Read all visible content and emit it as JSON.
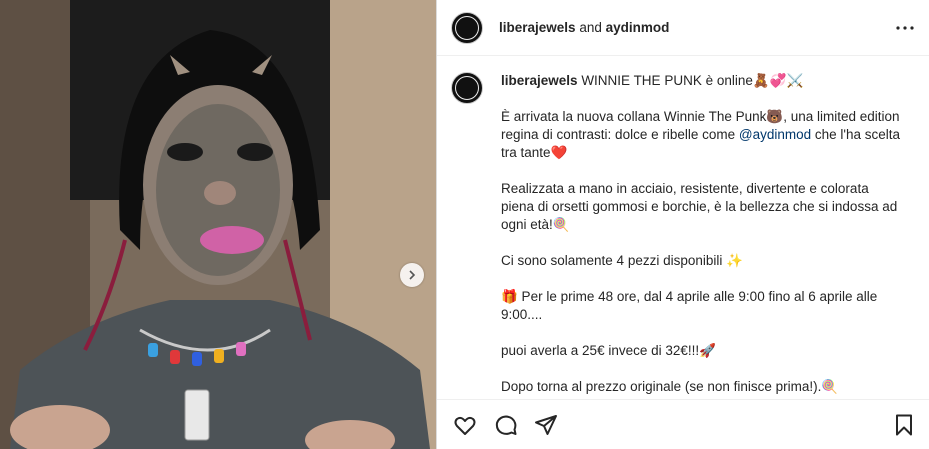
{
  "header": {
    "user1": "liberajewels",
    "and": "and",
    "user2": "aydinmod"
  },
  "caption": {
    "username": "liberajewels",
    "line1": "WINNIE THE PUNK è online🧸💞⚔️",
    "p2_a": "È arrivata la nuova collana Winnie The Punk🐻, una limited edition regina di contrasti: dolce e ribelle come ",
    "p2_mention": "@aydinmod",
    "p2_b": " che l'ha scelta tra tante❤️",
    "p3": "Realizzata a mano in acciaio, resistente, divertente e colorata piena di orsetti gommosi e borchie, è la bellezza che si indossa ad ogni età!🍭",
    "p4": "Ci sono solamente 4 pezzi disponibili ✨",
    "p5": "🎁 Per le prime 48 ore, dal 4 aprile alle 9:00 fino al 6 aprile alle 9:00....",
    "p6": "puoi averla a 25€ invece di 32€!!!🚀",
    "p7": "Dopo torna al prezzo originale (se non finisce prima!).🍭"
  },
  "icons": {
    "like": "heart-icon",
    "comment": "comment-icon",
    "share": "share-icon",
    "save": "bookmark-icon",
    "more": "more-icon",
    "next": "chevron-right-icon"
  }
}
